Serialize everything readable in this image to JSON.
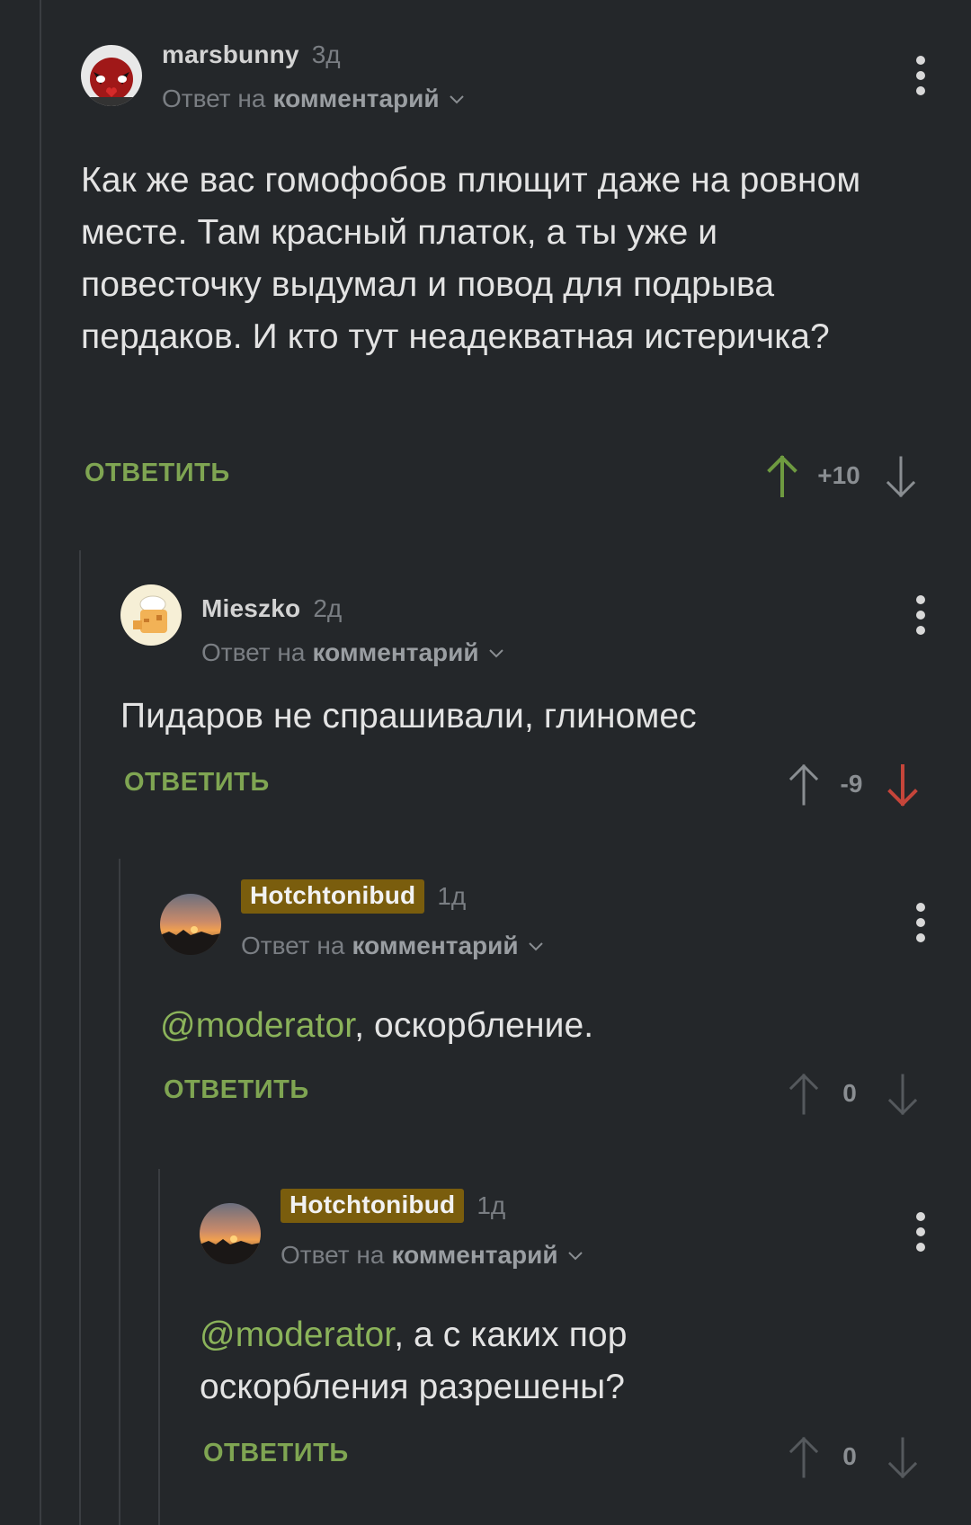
{
  "colors": {
    "background": "#24272a",
    "accent_green": "#7fa552",
    "mention_green": "#8bb35a",
    "badge_gold": "#7a5d0d",
    "downvote_red": "#c5453a"
  },
  "comments": [
    {
      "author": "marsbunny",
      "time": "3д",
      "reply_prefix": "Ответ на",
      "reply_link": "комментарий",
      "text": "Как же вас гомофобов плющит даже на ровном месте. Там красный платок, а ты уже и повесточку выдумал и повод для подрыва пердаков. И кто тут неадекватная истеричка?",
      "reply_label": "ОТВЕТИТЬ",
      "score": "+10",
      "upvoted": true
    },
    {
      "author": "Mieszko",
      "time": "2д",
      "reply_prefix": "Ответ на",
      "reply_link": "комментарий",
      "text": "Пидаров не спрашивали, глиномес",
      "reply_label": "ОТВЕТИТЬ",
      "score": "-9",
      "downvoted": true
    },
    {
      "author": "Hotchtonibud",
      "time": "1д",
      "reply_prefix": "Ответ на",
      "reply_link": "комментарий",
      "mention": "@moderator",
      "text": ", оскорбление.",
      "reply_label": "ОТВЕТИТЬ",
      "score": "0"
    },
    {
      "author": "Hotchtonibud",
      "time": "1д",
      "reply_prefix": "Ответ на",
      "reply_link": "комментарий",
      "mention": "@moderator",
      "text": ", а с каких пор оскорбления разрешены?",
      "reply_label": "ОТВЕТИТЬ",
      "score": "0"
    }
  ]
}
